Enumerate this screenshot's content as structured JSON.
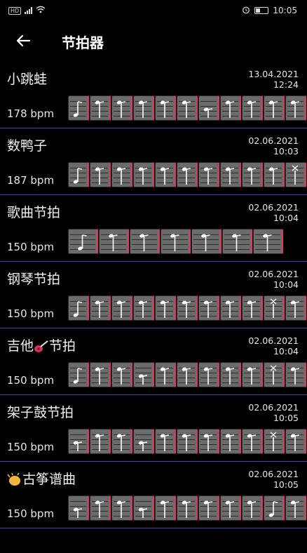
{
  "status_bar": {
    "time": "10:05",
    "left_badge": "HD"
  },
  "header": {
    "title": "节拍器"
  },
  "items": [
    {
      "name": "小跳蛙",
      "date": "13.04.2021",
      "time": "12:24",
      "bpm": "178 bpm",
      "beats": [
        "accent",
        "normal",
        "normal",
        "normal",
        "normal",
        "normal",
        "soft",
        "normal",
        "normal",
        "normal",
        "normal"
      ]
    },
    {
      "name": "数鸭子",
      "date": "02.06.2021",
      "time": "10:03",
      "bpm": "187 bpm",
      "beats": [
        "accent",
        "normal",
        "normal",
        "normal",
        "normal",
        "normal",
        "normal",
        "normal",
        "normal",
        "normal",
        "mute"
      ]
    },
    {
      "name": "歌曲节拍",
      "date": "02.06.2021",
      "time": "10:04",
      "bpm": "150 bpm",
      "beats": [
        "accent",
        "normal",
        "normal",
        "normal",
        "normal",
        "normal",
        "normal"
      ]
    },
    {
      "name": "钢琴节拍",
      "date": "02.06.2021",
      "time": "10:04",
      "bpm": "150 bpm",
      "beats": [
        "accent",
        "normal",
        "normal",
        "normal",
        "normal",
        "normal",
        "normal",
        "normal",
        "normal",
        "mute",
        "normal"
      ]
    },
    {
      "name_before": "吉他",
      "name_after": "节拍",
      "icon": "guitar-icon",
      "date": "02.06.2021",
      "time": "10:04",
      "bpm": "150 bpm",
      "beats": [
        "accent",
        "normal",
        "normal",
        "soft",
        "normal",
        "normal",
        "normal",
        "normal",
        "normal",
        "mute",
        "normal"
      ]
    },
    {
      "name": "架子鼓节拍",
      "date": "02.06.2021",
      "time": "10:05",
      "bpm": "150 bpm",
      "beats": [
        "soft",
        "normal",
        "normal",
        "soft",
        "normal",
        "normal",
        "normal",
        "normal",
        "normal",
        "mute",
        "normal"
      ]
    },
    {
      "name_before": "",
      "name_after": "古筝谱曲",
      "icon": "clapping-hands-icon",
      "date": "02.06.2021",
      "time": "10:05",
      "bpm": "150 bpm",
      "beats": [
        "soft",
        "normal",
        "normal",
        "soft",
        "normal",
        "normal",
        "normal",
        "normal",
        "normal",
        "accent",
        "normal"
      ]
    }
  ]
}
